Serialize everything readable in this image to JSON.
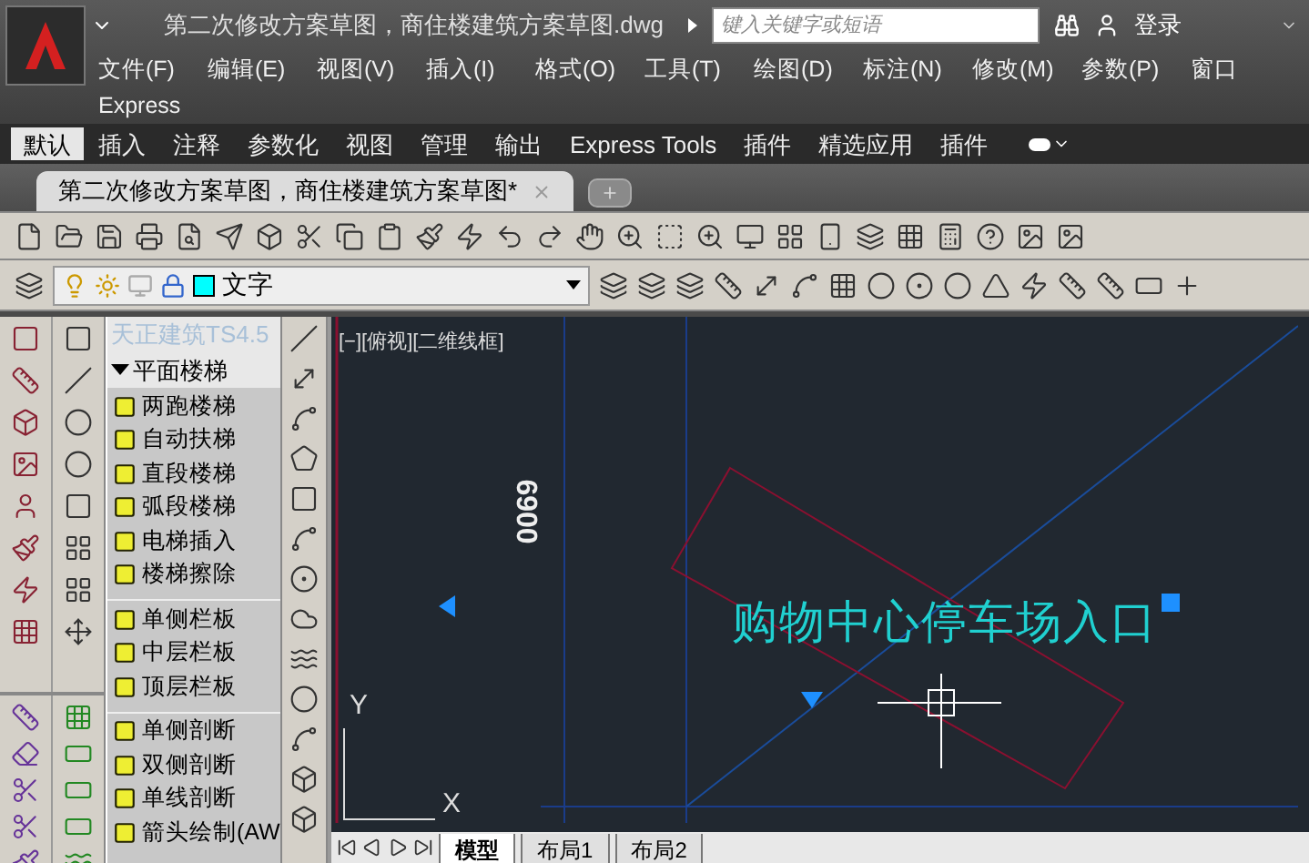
{
  "title_bar": {
    "title": "第二次修改方案草图，商住楼建筑方案草图.dwg",
    "search": {
      "placeholder": "键入关键字或短语"
    },
    "login": "登录"
  },
  "menu_bar": [
    "文件(F)",
    "编辑(E)",
    "视图(V)",
    "插入(I)",
    "格式(O)",
    "工具(T)",
    "绘图(D)",
    "标注(N)",
    "修改(M)",
    "参数(P)",
    "窗口",
    "Express"
  ],
  "ribbon_tabs": [
    {
      "label": "默认",
      "selected": true
    },
    {
      "label": "插入",
      "selected": false
    },
    {
      "label": "注释",
      "selected": false
    },
    {
      "label": "参数化",
      "selected": false
    },
    {
      "label": "视图",
      "selected": false
    },
    {
      "label": "管理",
      "selected": false
    },
    {
      "label": "输出",
      "selected": false
    },
    {
      "label": "Express Tools",
      "selected": false
    },
    {
      "label": "插件",
      "selected": false
    },
    {
      "label": "精选应用",
      "selected": false
    },
    {
      "label": "插件",
      "selected": false
    }
  ],
  "document_tabs": [
    {
      "label": "第二次修改方案草图，商住楼建筑方案草图*",
      "selected": true
    }
  ],
  "layer_control": {
    "value": "文字",
    "color": "#00ffff"
  },
  "tool_palette": {
    "title": "天正建筑TS4.5",
    "section": {
      "label": "平面楼梯",
      "expanded": true
    },
    "groups": [
      [
        "两跑楼梯",
        "自动扶梯",
        "直段楼梯",
        "弧段楼梯",
        "电梯插入",
        "楼梯擦除"
      ],
      [
        "单侧栏板",
        "中层栏板",
        "顶层栏板"
      ],
      [
        "单侧剖断",
        "双侧剖断",
        "单线剖断",
        "箭头绘制(AW"
      ]
    ]
  },
  "viewport": {
    "label": "[−][俯视][二维线框]",
    "dimension": "6900",
    "text": "购物中心停车场入口",
    "ucs": {
      "x": "X",
      "y": "Y"
    }
  },
  "layout_tabs": [
    {
      "label": "模型",
      "selected": true
    },
    {
      "label": "布局1",
      "selected": false
    },
    {
      "label": "布局2",
      "selected": false
    }
  ]
}
